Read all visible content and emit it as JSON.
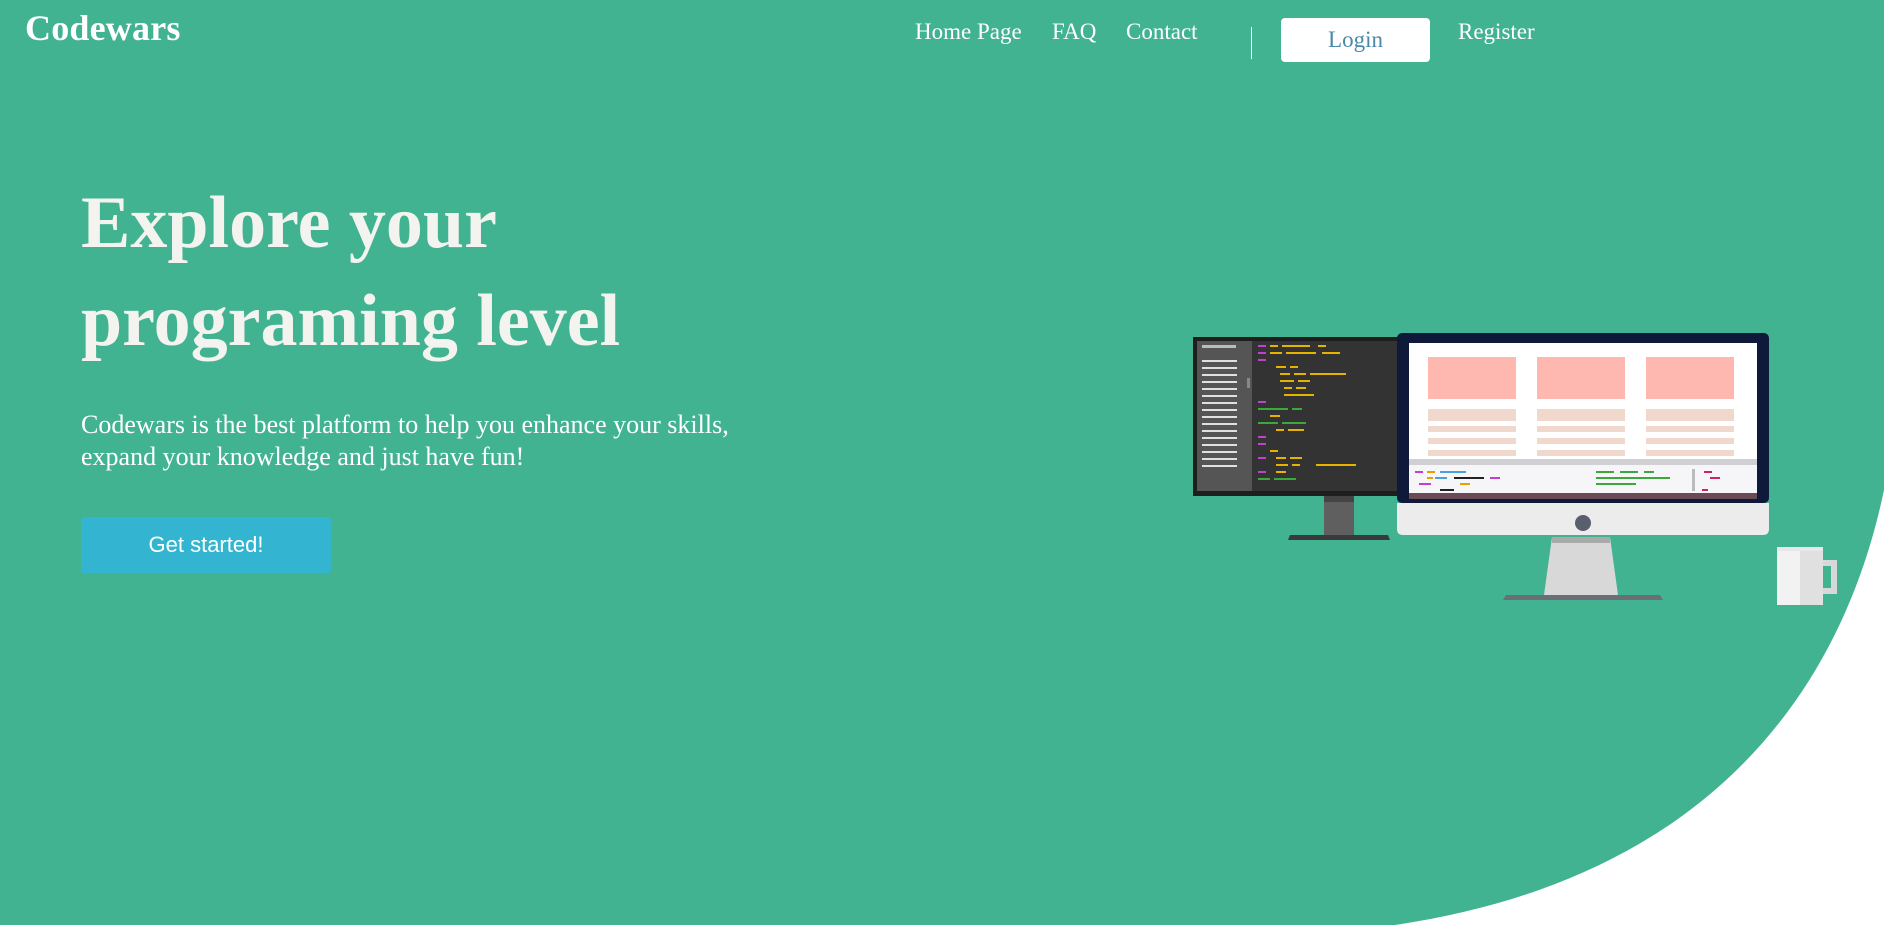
{
  "brand": {
    "name": "Codewars"
  },
  "nav": {
    "links": [
      "Home Page",
      "FAQ",
      "Contact"
    ],
    "login_label": "Login",
    "register_label": "Register"
  },
  "hero": {
    "title_lines": [
      "Explore your",
      "programing level"
    ],
    "subtitle_lines": [
      "Codewars is the best platform to help you enhance your skills,",
      "expand your knowledge and just have fun!"
    ],
    "cta_label": "Get started!"
  },
  "illustration": {
    "icon": "desktop-workspace-illustration"
  },
  "colors": {
    "background": "#42b390",
    "cta": "#33b5d2",
    "login_text": "#4a8aa8",
    "white": "#ffffff"
  }
}
